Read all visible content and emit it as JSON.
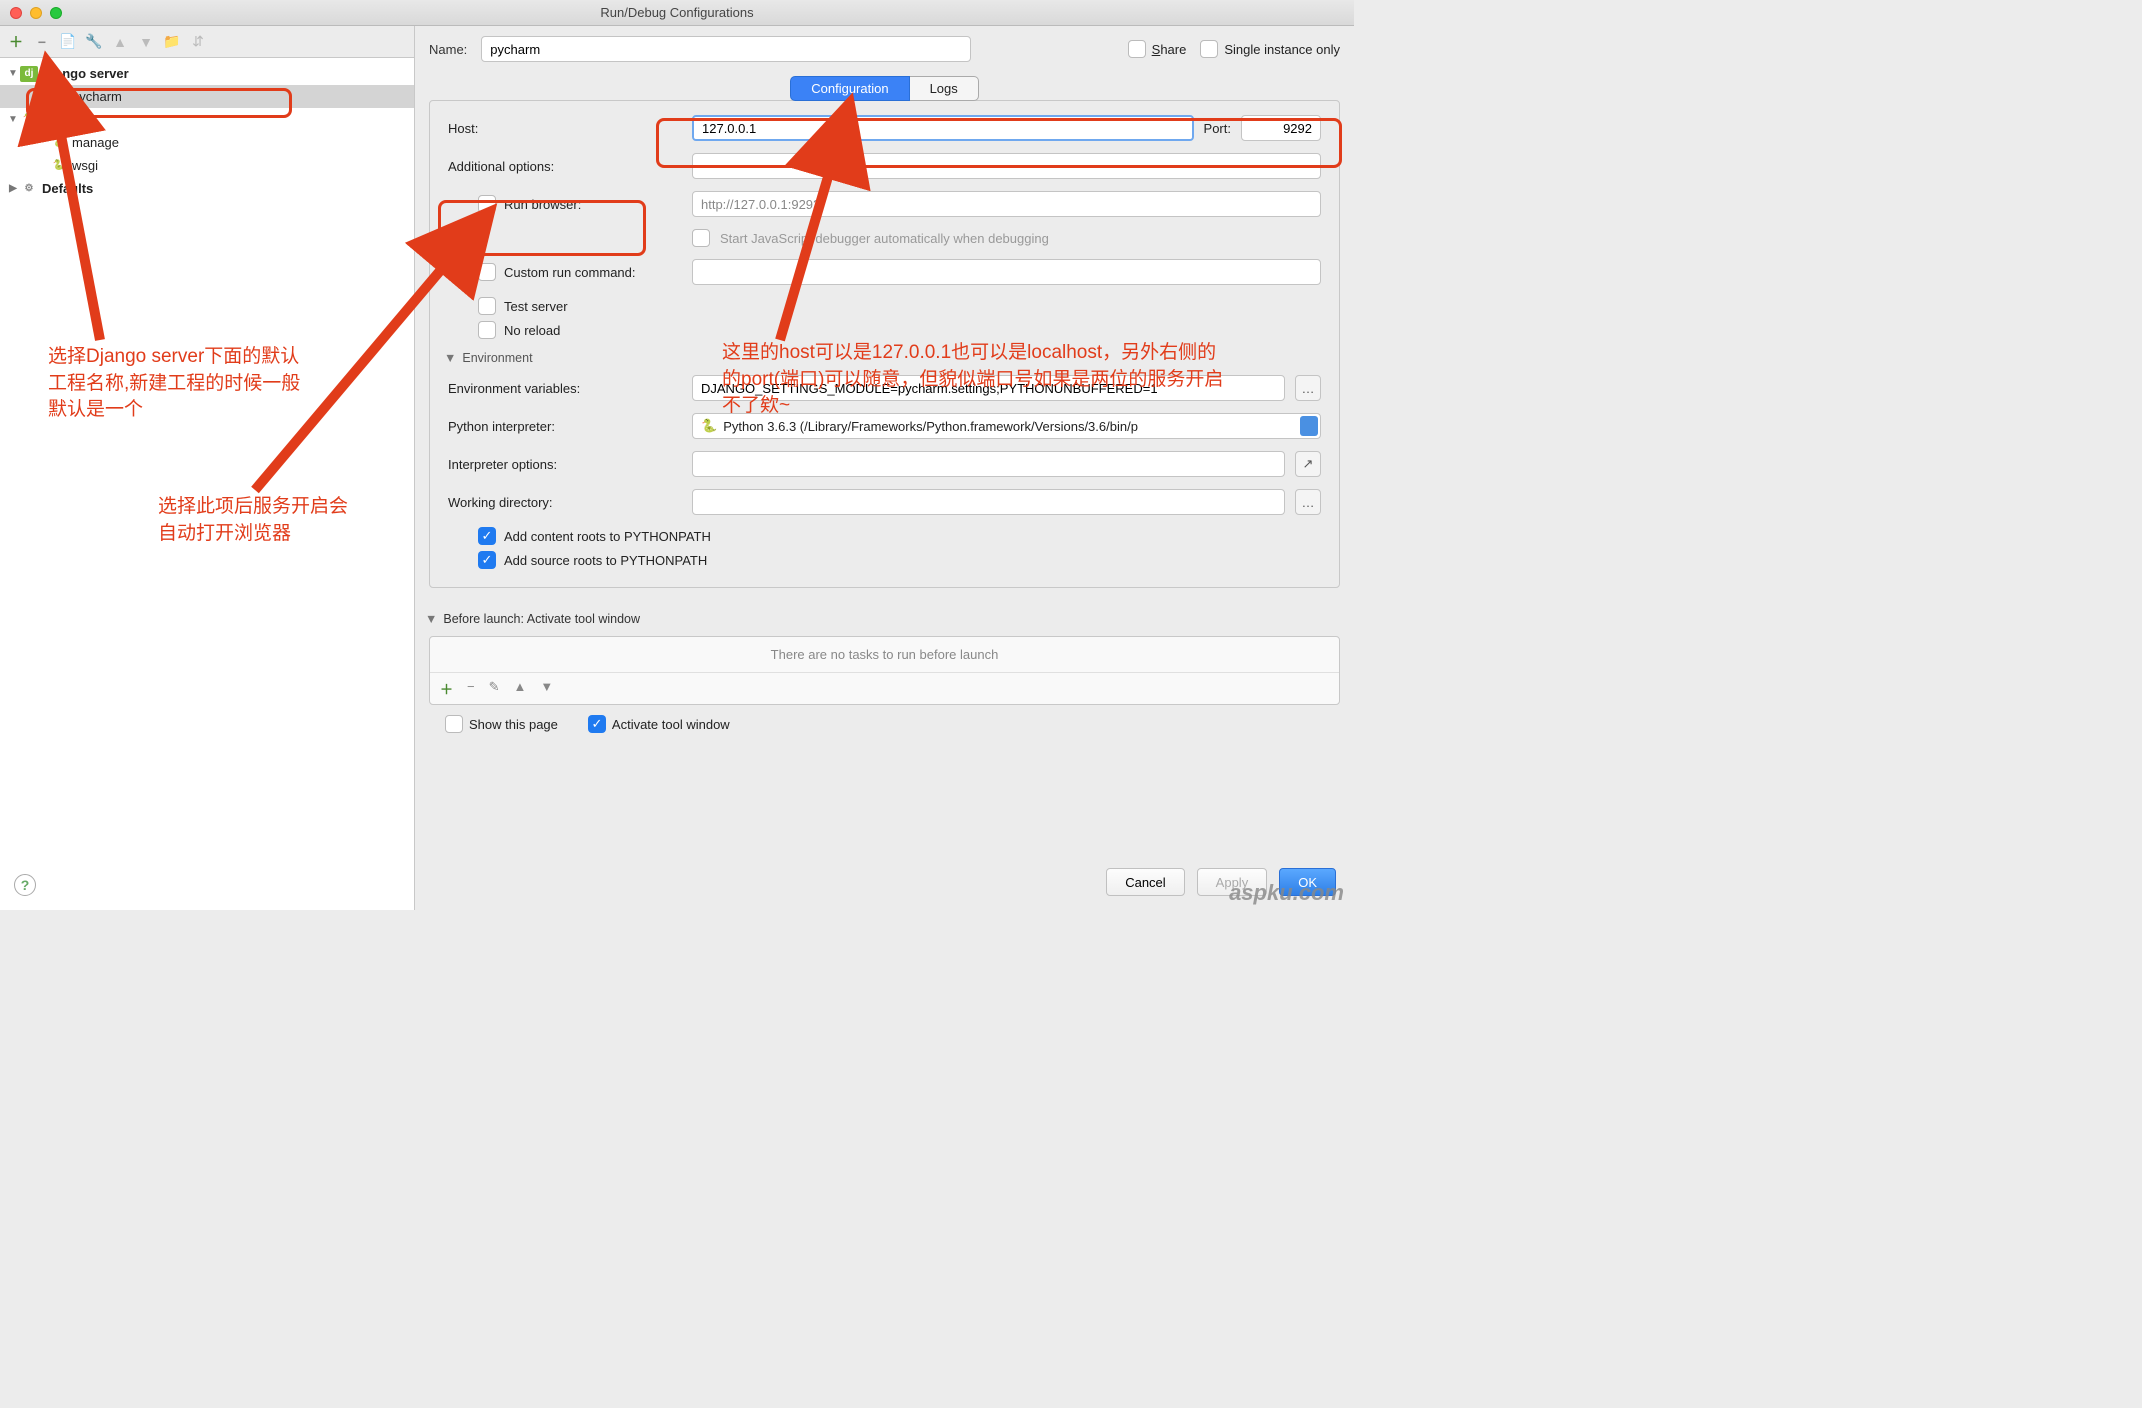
{
  "window": {
    "title": "Run/Debug Configurations"
  },
  "tree": {
    "django_server": "Django server",
    "django_children": [
      "pycharm"
    ],
    "python": "Python",
    "python_children": [
      "manage",
      "wsgi"
    ],
    "defaults": "Defaults"
  },
  "name_row": {
    "label": "Name:",
    "value": "pycharm",
    "share_label": "Share",
    "single_instance_label": "Single instance only"
  },
  "tabs": {
    "configuration": "Configuration",
    "logs": "Logs"
  },
  "config": {
    "host_label": "Host:",
    "host_value": "127.0.0.1",
    "port_label": "Port:",
    "port_value": "9292",
    "additional_options_label": "Additional options:",
    "additional_options_value": "",
    "run_browser_label": "Run browser:",
    "run_browser_url": "http://127.0.0.1:9292/",
    "start_js_debugger_label": "Start JavaScript debugger automatically when debugging",
    "custom_run_command_label": "Custom run command:",
    "custom_run_command_value": "",
    "test_server_label": "Test server",
    "no_reload_label": "No reload",
    "environment_header": "Environment",
    "env_vars_label": "Environment variables:",
    "env_vars_value": "DJANGO_SETTINGS_MODULE=pycharm.settings;PYTHONUNBUFFERED=1",
    "python_interpreter_label": "Python interpreter:",
    "python_interpreter_value": "Python 3.6.3 (/Library/Frameworks/Python.framework/Versions/3.6/bin/p",
    "interpreter_options_label": "Interpreter options:",
    "interpreter_options_value": "",
    "working_directory_label": "Working directory:",
    "working_directory_value": "",
    "add_content_roots_label": "Add content roots to PYTHONPATH",
    "add_source_roots_label": "Add source roots to PYTHONPATH"
  },
  "before_launch": {
    "header": "Before launch: Activate tool window",
    "empty_text": "There are no tasks to run before launch",
    "show_this_page_label": "Show this page",
    "activate_tool_window_label": "Activate tool window"
  },
  "footer": {
    "cancel": "Cancel",
    "apply": "Apply",
    "ok": "OK"
  },
  "annotations": {
    "tree_text": "选择Django server下面的默认\n工程名称,新建工程的时候一般\n默认是一个",
    "runbrowser_text": "选择此项后服务开启会\n自动打开浏览器",
    "host_text": "这里的host可以是127.0.0.1也可以是localhost，另外右侧的\n的port(端口)可以随意，但貌似端口号如果是两位的服务开启\n不了欸~"
  },
  "watermark": "aspku.com"
}
